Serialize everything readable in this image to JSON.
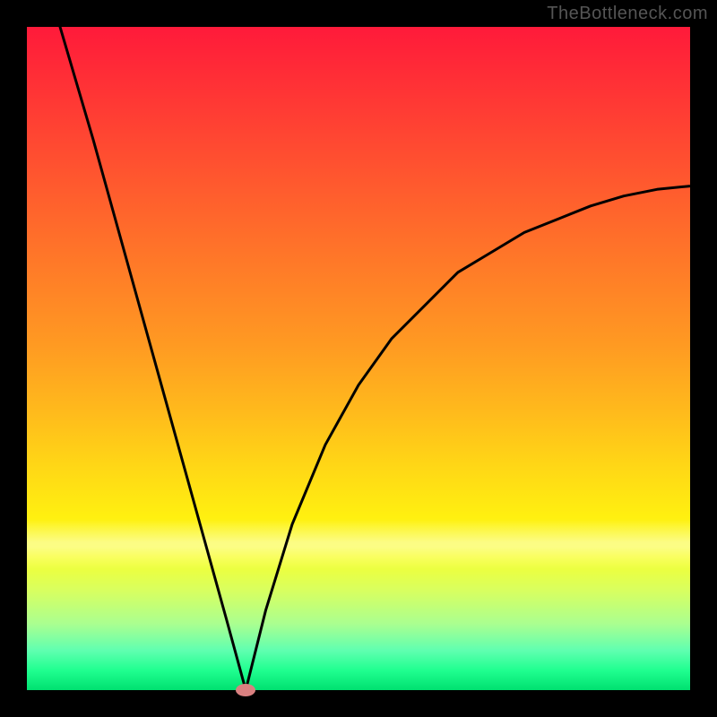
{
  "watermark": "TheBottleneck.com",
  "colors": {
    "frame_border": "#000000",
    "curve_stroke": "#000000",
    "marker_fill": "#d98080"
  },
  "chart_data": {
    "type": "line",
    "title": "",
    "xlabel": "",
    "ylabel": "",
    "x_range": [
      0,
      100
    ],
    "y_range": [
      0,
      100
    ],
    "notes": "Bottleneck-style heatmap with a single black V-shaped curve. y≈0 is green (no bottleneck), y≈100 is red (severe bottleneck). Curve minimum ≈ x=33, y≈0. Pink ellipse marks location of minimum.",
    "series": [
      {
        "name": "bottleneck-curve",
        "x": [
          0,
          5,
          10,
          15,
          20,
          25,
          30,
          33,
          36,
          40,
          45,
          50,
          55,
          60,
          65,
          70,
          75,
          80,
          85,
          90,
          95,
          100
        ],
        "values": [
          118,
          100,
          83,
          65,
          47,
          29,
          11,
          0,
          12,
          25,
          37,
          46,
          53,
          58,
          63,
          66,
          69,
          71,
          73,
          74.5,
          75.5,
          76
        ]
      }
    ],
    "marker": {
      "x": 33,
      "y": 0,
      "comment": "optimum / zero-bottleneck point"
    },
    "gradient_heat": {
      "orientation": "vertical",
      "stops": [
        {
          "pct": 0,
          "label": "top",
          "color": "#ff1a3a",
          "meaning": "high bottleneck"
        },
        {
          "pct": 50,
          "label": "mid",
          "color": "#ffba1c",
          "meaning": "moderate"
        },
        {
          "pct": 100,
          "label": "bottom",
          "color": "#00e070",
          "meaning": "none"
        }
      ]
    }
  }
}
